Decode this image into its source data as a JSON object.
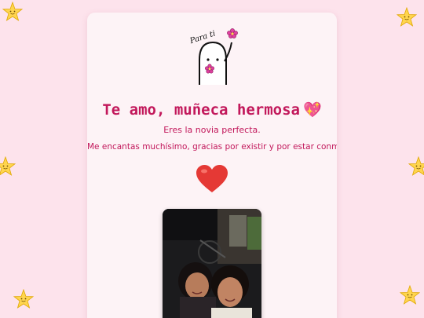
{
  "sticker": {
    "text": "Para ti",
    "icon": "flork-with-flower-icon"
  },
  "card": {
    "title": "Te amo, muñeca hermosa",
    "title_emoji": "💖",
    "subtitle": "Eres la novia perfecta.",
    "message": "Me encantas muchísimo, gracias por existir y por estar conmigo.",
    "heart_icon": "red-heart-icon",
    "photo": "couple-selfie-photo"
  },
  "decorations": {
    "icon": "smiling-star-icon",
    "count": 8
  },
  "colors": {
    "background": "#fde3ec",
    "card": "#fdf3f6",
    "accent": "#c2185b",
    "heart": "#e53935",
    "star": "#ffd54f"
  }
}
